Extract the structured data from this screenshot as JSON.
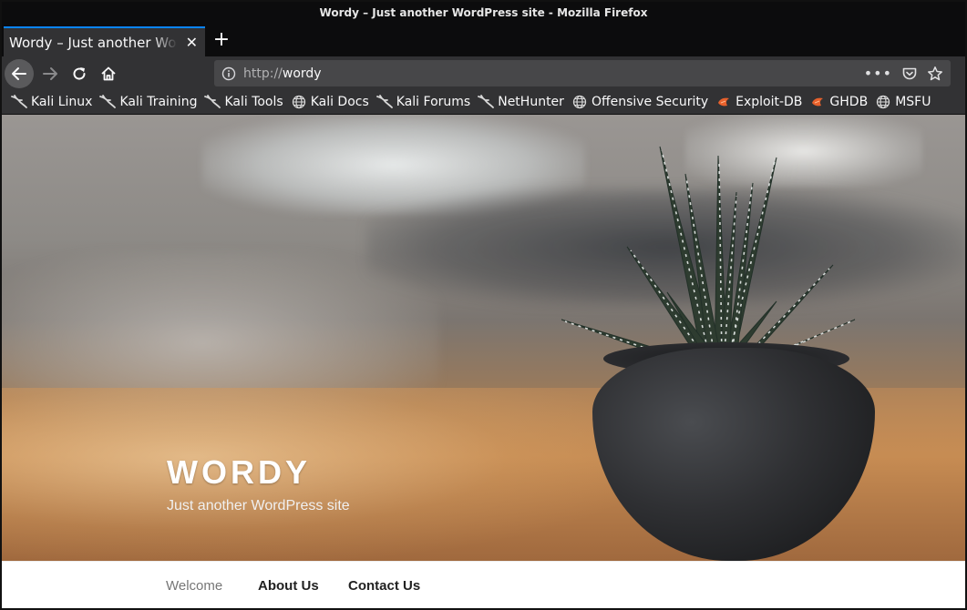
{
  "window": {
    "title": "Wordy – Just another WordPress site - Mozilla Firefox"
  },
  "tabs": [
    {
      "title": "Wordy – Just another WordPress site",
      "active": true
    }
  ],
  "toolbar": {
    "url_scheme": "http://",
    "url_host": "wordy"
  },
  "bookmarks": [
    {
      "label": "Kali Linux",
      "icon": "kali-dragon-icon"
    },
    {
      "label": "Kali Training",
      "icon": "kali-dragon-icon"
    },
    {
      "label": "Kali Tools",
      "icon": "kali-dragon-icon"
    },
    {
      "label": "Kali Docs",
      "icon": "globe-icon"
    },
    {
      "label": "Kali Forums",
      "icon": "kali-dragon-icon"
    },
    {
      "label": "NetHunter",
      "icon": "kali-dragon-icon"
    },
    {
      "label": "Offensive Security",
      "icon": "globe-icon"
    },
    {
      "label": "Exploit-DB",
      "icon": "exploitdb-icon"
    },
    {
      "label": "GHDB",
      "icon": "exploitdb-icon"
    },
    {
      "label": "MSFU",
      "icon": "globe-icon"
    }
  ],
  "site": {
    "title": "WORDY",
    "description": "Just another WordPress site",
    "menu": [
      {
        "label": "Welcome",
        "current": true
      },
      {
        "label": "About Us",
        "current": false
      },
      {
        "label": "Contact Us",
        "current": false
      }
    ]
  },
  "colors": {
    "accent": "#0a84ff",
    "chrome_dark": "#0c0c0d",
    "chrome": "#323234",
    "urlbar": "#474749"
  }
}
